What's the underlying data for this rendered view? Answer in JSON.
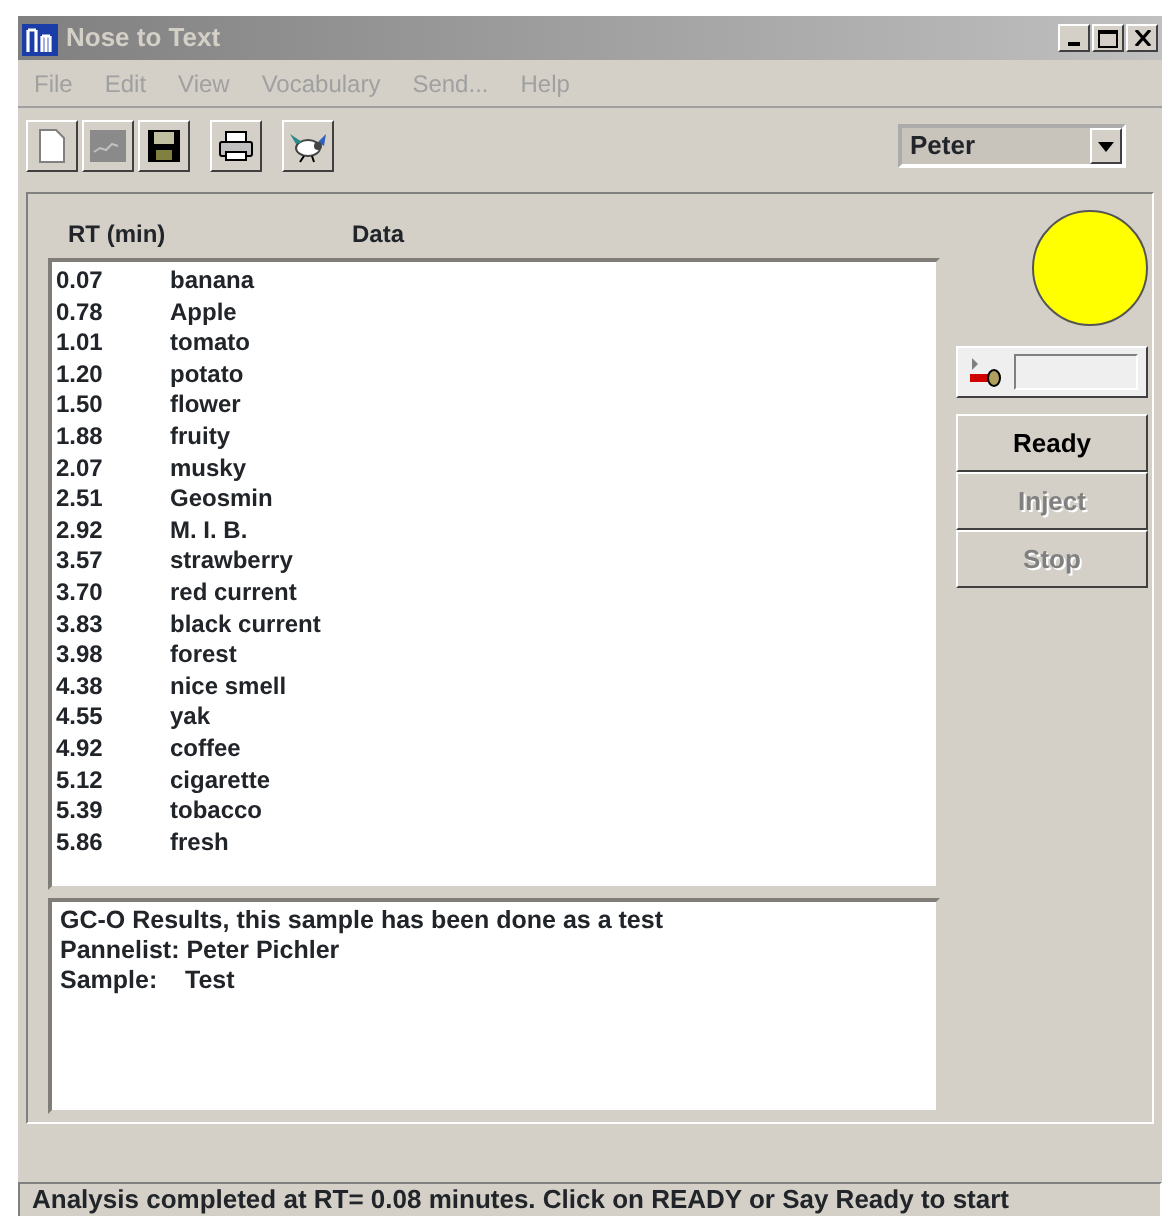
{
  "window": {
    "title": "Nose to Text"
  },
  "menu": [
    {
      "label": "File",
      "disabled": true
    },
    {
      "label": "Edit",
      "disabled": true
    },
    {
      "label": "View",
      "disabled": true
    },
    {
      "label": "Vocabulary",
      "disabled": true
    },
    {
      "label": "Send...",
      "disabled": true
    },
    {
      "label": "Help",
      "disabled": true
    }
  ],
  "toolbar": [
    {
      "kind": "new"
    },
    {
      "kind": "chart"
    },
    {
      "kind": "save"
    },
    {
      "kind": "print"
    },
    {
      "kind": "bird"
    }
  ],
  "user_select": {
    "value": "Peter"
  },
  "table": {
    "columns": [
      "RT (min)",
      "Data"
    ],
    "rows": [
      [
        "0.07",
        "banana"
      ],
      [
        "0.78",
        "Apple"
      ],
      [
        "1.01",
        "tomato"
      ],
      [
        "1.20",
        "potato"
      ],
      [
        "1.50",
        "flower"
      ],
      [
        "1.88",
        "fruity"
      ],
      [
        "2.07",
        "musky"
      ],
      [
        "2.51",
        "Geosmin"
      ],
      [
        "2.92",
        "M. I. B."
      ],
      [
        "3.57",
        "strawberry"
      ],
      [
        "3.70",
        "red current"
      ],
      [
        "3.83",
        "black current"
      ],
      [
        "3.98",
        "forest"
      ],
      [
        "4.38",
        "nice smell"
      ],
      [
        "4.55",
        "yak"
      ],
      [
        "4.92",
        "coffee"
      ],
      [
        "5.12",
        "cigarette"
      ],
      [
        "5.39",
        "tobacco"
      ],
      [
        "5.86",
        "fresh"
      ]
    ]
  },
  "results": [
    "GC-O Results, this sample has been done as a test",
    "Pannelist: Peter Pichler",
    "Sample:    Test"
  ],
  "indicator": {
    "color": "#ffff00"
  },
  "buttons": [
    {
      "label": "Ready",
      "disabled": false
    },
    {
      "label": "Inject",
      "disabled": true
    },
    {
      "label": "Stop",
      "disabled": true
    }
  ],
  "status_bar": "Analysis completed at RT= 0.08 minutes. Click on READY or Say Ready to start"
}
